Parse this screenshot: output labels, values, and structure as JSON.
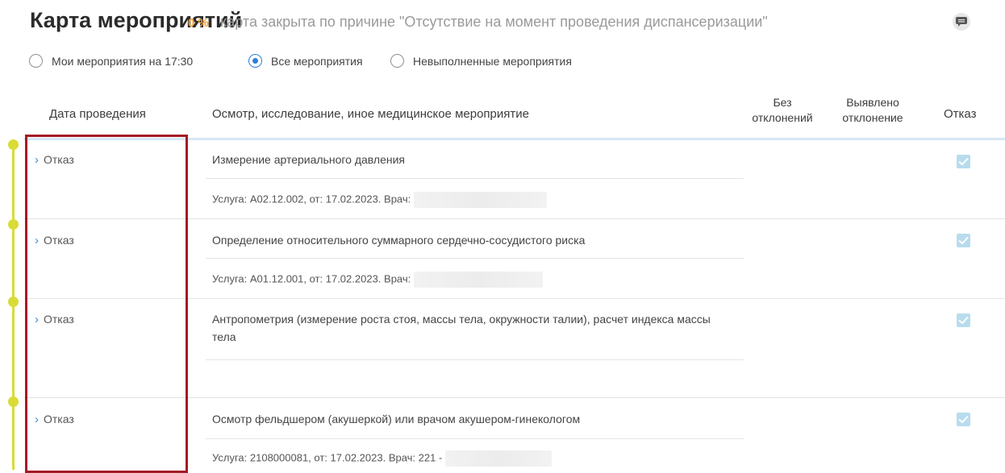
{
  "header": {
    "title": "Карта мероприятий",
    "percent": "0 %",
    "closed_reason": "карта закрыта по причине \"Отсутствие на момент проведения диспансеризации\"",
    "comment_icon": "comment-icon"
  },
  "filters": {
    "options": [
      {
        "label": "Мои мероприятия на 17:30",
        "checked": false
      },
      {
        "label": "Все мероприятия",
        "checked": true
      },
      {
        "label": "Невыполненные мероприятия",
        "checked": false
      }
    ]
  },
  "table": {
    "columns": {
      "date": "Дата проведения",
      "event": "Осмотр, исследование, иное медицинское мероприятие",
      "no_deviation_1": "Без",
      "no_deviation_2": "отклонений",
      "deviation_1": "Выявлено",
      "deviation_2": "отклонение",
      "refusal": "Отказ"
    },
    "rows": [
      {
        "date": "Отказ",
        "event": "Измерение артериального давления",
        "service": "Услуга: A02.12.002, от: 17.02.2023. Врач:",
        "refused": true
      },
      {
        "date": "Отказ",
        "event": "Определение относительного суммарного сердечно-сосудистого риска",
        "service": "Услуга: A01.12.001, от: 17.02.2023. Врач:",
        "refused": true
      },
      {
        "date": "Отказ",
        "event": "Антропометрия (измерение роста стоя, массы тела, окружности талии), расчет индекса массы тела",
        "service": "",
        "refused": true
      },
      {
        "date": "Отказ",
        "event": "Осмотр фельдшером (акушеркой) или врачом акушером-гинекологом",
        "service": "Услуга: 2108000081, от: 17.02.2023. Врач: 221 -",
        "refused": true
      }
    ]
  },
  "colors": {
    "accent": "#2f7fd6",
    "percent": "#f0a032",
    "timeline": "#d8dc35",
    "highlight": "#a41a24",
    "checkbox": "#b8dcee"
  }
}
